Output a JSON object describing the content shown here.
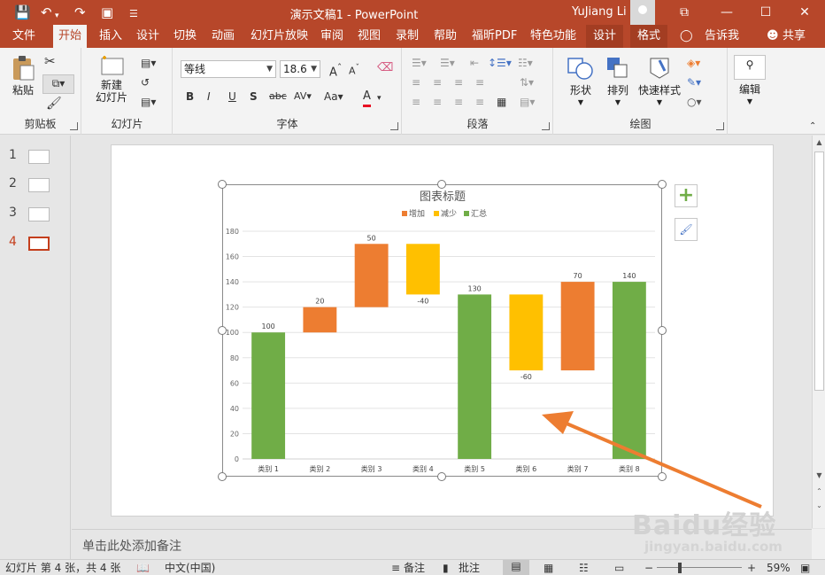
{
  "title_bar": {
    "doc_title": "演示文稿1  -  PowerPoint",
    "user_name": "YuJiang Li"
  },
  "tabs": [
    {
      "label": "文件"
    },
    {
      "label": "开始"
    },
    {
      "label": "插入"
    },
    {
      "label": "设计"
    },
    {
      "label": "切换"
    },
    {
      "label": "动画"
    },
    {
      "label": "幻灯片放映"
    },
    {
      "label": "审阅"
    },
    {
      "label": "视图"
    },
    {
      "label": "录制"
    },
    {
      "label": "帮助"
    },
    {
      "label": "福昕PDF"
    },
    {
      "label": "特色功能"
    },
    {
      "label": "设计"
    },
    {
      "label": "格式"
    }
  ],
  "tell_me": "告诉我",
  "share": "共享",
  "ribbon": {
    "clipboard": {
      "paste": "粘贴",
      "label": "剪贴板"
    },
    "slides": {
      "new_slide_l1": "新建",
      "new_slide_l2": "幻灯片",
      "label": "幻灯片"
    },
    "font": {
      "font_name": "等线",
      "font_size": "18.6",
      "label": "字体"
    },
    "paragraph": {
      "label": "段落"
    },
    "drawing": {
      "shape": "形状",
      "arrange": "排列",
      "quick_styles": "快速样式",
      "label": "绘图"
    },
    "editing": {
      "label": "编辑"
    }
  },
  "thumbnails": [
    {
      "num": "1"
    },
    {
      "num": "2"
    },
    {
      "num": "3"
    },
    {
      "num": "4"
    }
  ],
  "chart_data": {
    "type": "bar",
    "subtype": "waterfall",
    "title": "图表标题",
    "legend": [
      "增加",
      "减少",
      "汇总"
    ],
    "legend_placement": "top",
    "categories": [
      "类别 1",
      "类别 2",
      "类别 3",
      "类别 4",
      "类别 5",
      "类别 6",
      "类别 7",
      "类别 8"
    ],
    "values": [
      100,
      20,
      50,
      -40,
      130,
      -60,
      70,
      140
    ],
    "kinds": [
      "汇总",
      "增加",
      "增加",
      "减少",
      "汇总",
      "减少",
      "增加",
      "汇总"
    ],
    "data_labels": [
      "100",
      "20",
      "50",
      "-40",
      "130",
      "-60",
      "70",
      "140"
    ],
    "ylim": [
      0,
      180
    ],
    "yticks": [
      0,
      20,
      40,
      60,
      80,
      100,
      120,
      140,
      160,
      180
    ],
    "grid": true,
    "colors": {
      "增加": "#ed7d31",
      "减少": "#ffc000",
      "汇总": "#70ad47"
    }
  },
  "notes_placeholder": "单击此处添加备注",
  "status": {
    "slide_info": "幻灯片 第 4 张，共 4 张",
    "language": "中文(中国)",
    "notes": "备注",
    "comments": "批注",
    "zoom": "59%"
  },
  "watermark": {
    "line1": "Baidu经验",
    "line2": "jingyan.baidu.com"
  },
  "accent_color": "#b7472a"
}
